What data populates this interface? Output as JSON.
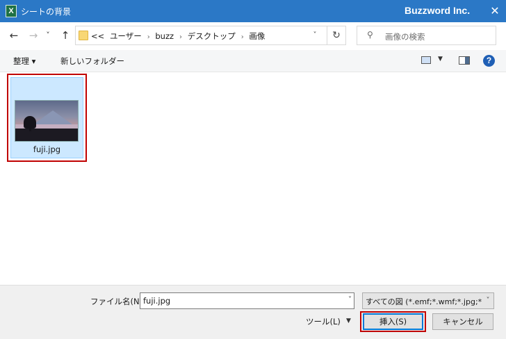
{
  "window": {
    "app_icon": "excel-icon",
    "app_icon_letter": "X",
    "title": "シートの背景",
    "company": "Buzzword Inc.",
    "close_glyph": "✕"
  },
  "nav": {
    "back_glyph": "←",
    "forward_glyph": "→",
    "recent_glyph": "˅",
    "up_glyph": "↑"
  },
  "address": {
    "overflow": "<<",
    "crumbs": [
      "ユーザー",
      "buzz",
      "デスクトップ",
      "画像"
    ],
    "sep_glyph": "›",
    "dropdown_glyph": "˅",
    "refresh_glyph": "↻"
  },
  "search": {
    "icon": "search-icon",
    "icon_glyph": "⚲",
    "placeholder": "画像の検索"
  },
  "toolbar": {
    "organize_label": "整理 ▾",
    "new_folder_label": "新しいフォルダー",
    "view_dropdown_glyph": "▼",
    "help_glyph": "?"
  },
  "files": [
    {
      "name": "fuji.jpg",
      "selected": true,
      "highlighted": true
    }
  ],
  "bottom": {
    "filename_label": "ファイル名(N):",
    "filename_value": "fuji.jpg",
    "filename_dropdown_glyph": "˅",
    "filter_value": "すべての図 (*.emf;*.wmf;*.jpg;*.jp",
    "filter_dropdown_glyph": "˅",
    "tools_label": "ツール(L)",
    "tools_dropdown_glyph": "▼",
    "insert_label": "挿入(S)",
    "cancel_label": "キャンセル"
  },
  "colors": {
    "titlebar": "#2b78c6",
    "selection": "#cce8ff",
    "highlight_border": "#c00000",
    "primary_border": "#0078d7"
  }
}
